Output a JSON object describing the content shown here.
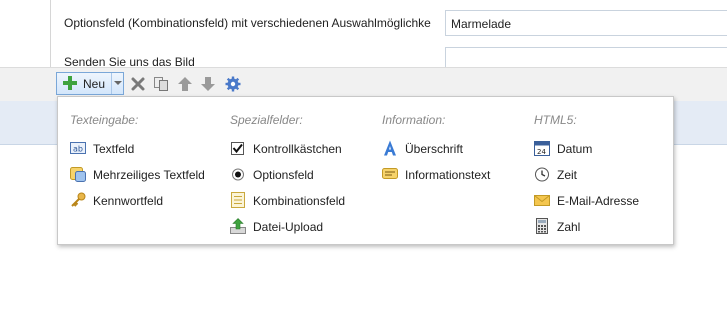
{
  "form": {
    "row1_label": "Optionsfeld (Kombinationsfeld) mit verschiedenen Auswahlmöglichke",
    "row1_value": "Marmelade",
    "row2_label": "Senden Sie uns das Bild"
  },
  "toolbar": {
    "new_label": "Neu",
    "icons": [
      "add-icon",
      "dropdown-caret-icon",
      "delete-icon",
      "copy-icon",
      "move-up-icon",
      "move-down-icon",
      "settings-icon"
    ]
  },
  "menu": {
    "groups": [
      {
        "title": "Texteingabe:",
        "items": [
          {
            "label": "Textfeld",
            "icon": "textbox-icon"
          },
          {
            "label": "Mehrzeiliges Textfeld",
            "icon": "multiline-textbox-icon"
          },
          {
            "label": "Kennwortfeld",
            "icon": "key-icon"
          }
        ]
      },
      {
        "title": "Spezialfelder:",
        "items": [
          {
            "label": "Kontrollkästchen",
            "icon": "checkbox-icon"
          },
          {
            "label": "Optionsfeld",
            "icon": "radio-icon"
          },
          {
            "label": "Kombinationsfeld",
            "icon": "combobox-icon"
          },
          {
            "label": "Datei-Upload",
            "icon": "upload-icon"
          }
        ]
      },
      {
        "title": "Information:",
        "items": [
          {
            "label": "Überschrift",
            "icon": "heading-icon"
          },
          {
            "label": "Informationstext",
            "icon": "info-text-icon"
          }
        ]
      },
      {
        "title": "HTML5:",
        "items": [
          {
            "label": "Datum",
            "icon": "calendar-icon"
          },
          {
            "label": "Zeit",
            "icon": "clock-icon"
          },
          {
            "label": "E-Mail-Adresse",
            "icon": "envelope-icon"
          },
          {
            "label": "Zahl",
            "icon": "calculator-icon"
          }
        ]
      }
    ]
  },
  "calendar_day": "24",
  "colors": {
    "accent_blue": "#3a7bd5",
    "button_border": "#7aa7d8",
    "band": "#e4ebf5",
    "group_title": "#888888"
  }
}
